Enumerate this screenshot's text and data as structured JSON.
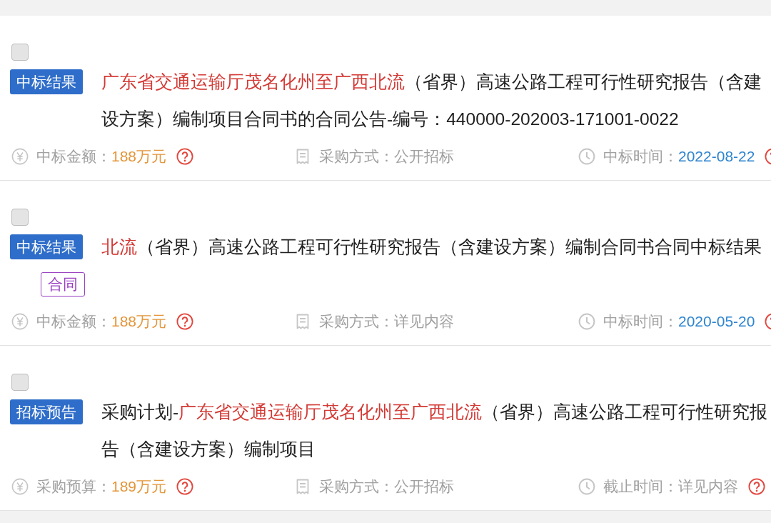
{
  "results": [
    {
      "checked": false,
      "category": "中标结果",
      "title": [
        {
          "text": "广东省交通运输厅茂名化州至广西北流",
          "highlight": true
        },
        {
          "text": "（省界）高速公路工程可行性研究报告（含建设方案）编制项目合同书的合同公告-编号：440000-202003-171001-0022",
          "highlight": false
        }
      ],
      "meta": [
        {
          "kind": "amount",
          "label": "中标金额：",
          "value": "188万元",
          "help": true
        },
        {
          "kind": "method",
          "label": "采购方式：",
          "value": "公开招标",
          "help": false
        },
        {
          "kind": "award_date",
          "label": "中标时间：",
          "value": "2022-08-22",
          "help": true
        }
      ]
    },
    {
      "checked": false,
      "category": "中标结果",
      "title": [
        {
          "text": "北流",
          "highlight": true
        },
        {
          "text": "（省界）高速公路工程可行性研究报告（含建设方案）编制合同书合同中标结果",
          "highlight": false
        }
      ],
      "badges": [
        {
          "text": "合同"
        }
      ],
      "meta": [
        {
          "kind": "amount",
          "label": "中标金额：",
          "value": "188万元",
          "help": true
        },
        {
          "kind": "method",
          "label": "采购方式：",
          "value": "详见内容",
          "help": false
        },
        {
          "kind": "award_date",
          "label": "中标时间：",
          "value": "2020-05-20",
          "help": true
        }
      ]
    },
    {
      "checked": false,
      "category": "招标预告",
      "title": [
        {
          "text": "采购计划-",
          "highlight": false
        },
        {
          "text": "广东省交通运输厅茂名化州至广西北流",
          "highlight": true
        },
        {
          "text": "（省界）高速公路工程可行性研究报告（含建设方案）编制项目",
          "highlight": false
        }
      ],
      "meta": [
        {
          "kind": "amount",
          "label": "采购预算：",
          "value": "189万元",
          "help": true
        },
        {
          "kind": "method",
          "label": "采购方式：",
          "value": "公开招标",
          "help": false
        },
        {
          "kind": "deadline",
          "label": "截止时间：",
          "value": "详见内容",
          "help": true
        }
      ]
    }
  ]
}
